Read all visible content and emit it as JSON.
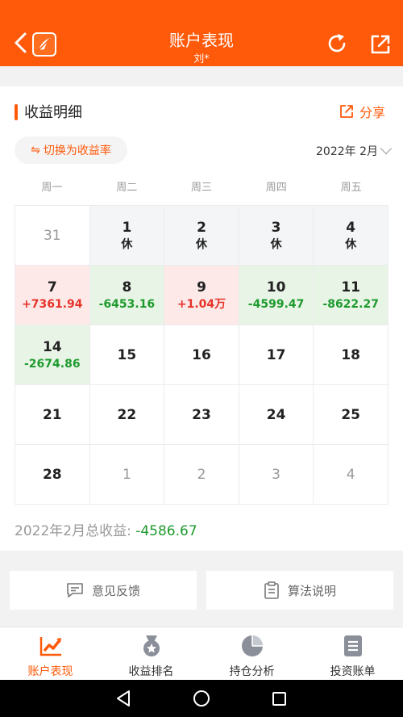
{
  "header": {
    "title": "账户表现",
    "subtitle": "刘*"
  },
  "section": {
    "title": "收益明细",
    "share_label": "分享"
  },
  "toggle": {
    "label": "切换为收益率"
  },
  "month_selector": {
    "label": "2022年 2月"
  },
  "weekdays": [
    "周一",
    "周二",
    "周三",
    "周四",
    "周五"
  ],
  "calendar": [
    {
      "day": "31",
      "value": "",
      "state": "muted"
    },
    {
      "day": "1",
      "value": "休",
      "state": "gray"
    },
    {
      "day": "2",
      "value": "休",
      "state": "gray"
    },
    {
      "day": "3",
      "value": "休",
      "state": "gray"
    },
    {
      "day": "4",
      "value": "休",
      "state": "gray"
    },
    {
      "day": "7",
      "value": "+7361.94",
      "state": "red"
    },
    {
      "day": "8",
      "value": "-6453.16",
      "state": "green"
    },
    {
      "day": "9",
      "value": "+1.04万",
      "state": "red"
    },
    {
      "day": "10",
      "value": "-4599.47",
      "state": "green"
    },
    {
      "day": "11",
      "value": "-8622.27",
      "state": "green"
    },
    {
      "day": "14",
      "value": "-2674.86",
      "state": "green"
    },
    {
      "day": "15",
      "value": "",
      "state": "normal"
    },
    {
      "day": "16",
      "value": "",
      "state": "normal"
    },
    {
      "day": "17",
      "value": "",
      "state": "normal"
    },
    {
      "day": "18",
      "value": "",
      "state": "normal"
    },
    {
      "day": "21",
      "value": "",
      "state": "normal"
    },
    {
      "day": "22",
      "value": "",
      "state": "normal"
    },
    {
      "day": "23",
      "value": "",
      "state": "normal"
    },
    {
      "day": "24",
      "value": "",
      "state": "normal"
    },
    {
      "day": "25",
      "value": "",
      "state": "normal"
    },
    {
      "day": "28",
      "value": "",
      "state": "normal"
    },
    {
      "day": "1",
      "value": "",
      "state": "muted"
    },
    {
      "day": "2",
      "value": "",
      "state": "muted"
    },
    {
      "day": "3",
      "value": "",
      "state": "muted"
    },
    {
      "day": "4",
      "value": "",
      "state": "muted"
    }
  ],
  "total": {
    "label": "2022年2月总收益: ",
    "value": "-4586.67"
  },
  "actions": {
    "feedback_label": "意见反馈",
    "algorithm_label": "算法说明"
  },
  "tabs": [
    {
      "label": "账户表现",
      "icon": "trend-chart-icon",
      "active": true
    },
    {
      "label": "收益排名",
      "icon": "medal-icon",
      "active": false
    },
    {
      "label": "持仓分析",
      "icon": "pie-chart-icon",
      "active": false
    },
    {
      "label": "投资账单",
      "icon": "document-icon",
      "active": false
    }
  ],
  "colors": {
    "brand": "#ff5a0a",
    "gain": "#e5342a",
    "loss": "#1e9a2e"
  }
}
